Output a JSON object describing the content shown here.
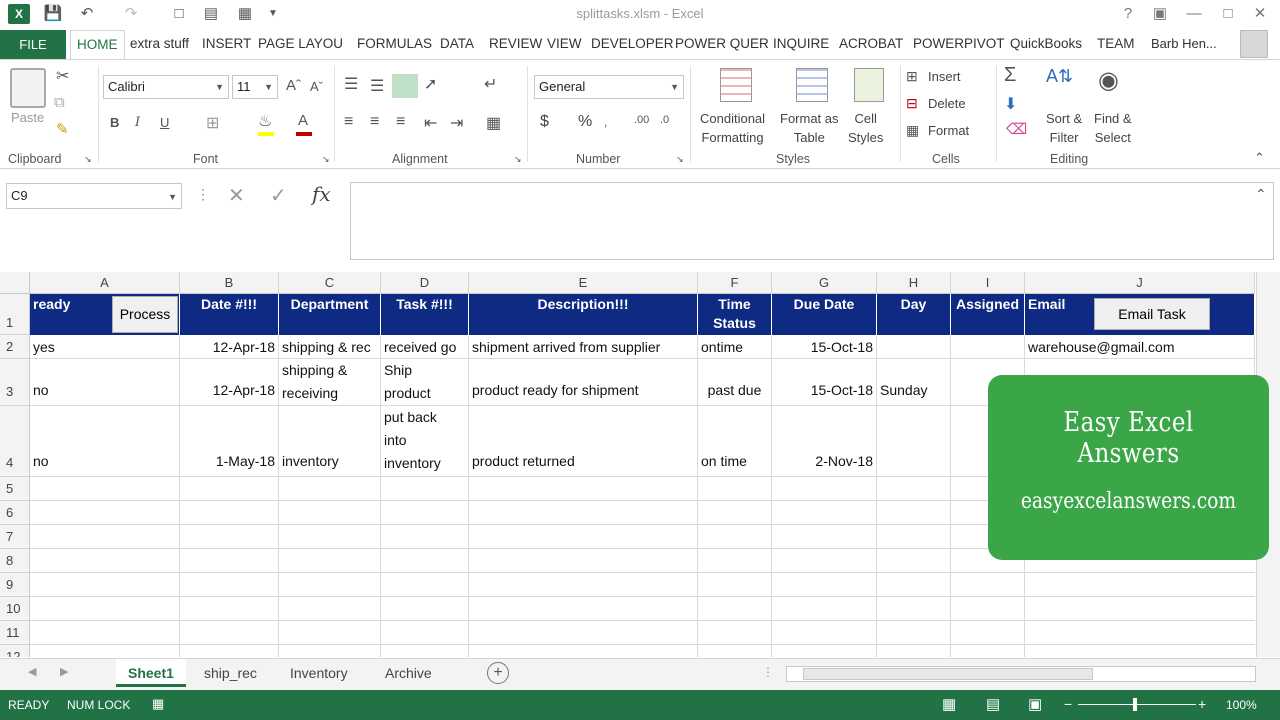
{
  "window": {
    "title": "splittasks.xlsm - Excel",
    "user": "Barb Hen..."
  },
  "tabs": [
    "FILE",
    "HOME",
    "extra stuff",
    "INSERT",
    "PAGE LAYOU",
    "FORMULAS",
    "DATA",
    "REVIEW",
    "VIEW",
    "DEVELOPER",
    "POWER QUER",
    "INQUIRE",
    "ACROBAT",
    "POWERPIVOT",
    "QuickBooks",
    "TEAM"
  ],
  "ribbon": {
    "clipboard": {
      "label": "Clipboard",
      "paste": "Paste"
    },
    "font": {
      "label": "Font",
      "name": "Calibri",
      "size": "11"
    },
    "alignment": {
      "label": "Alignment"
    },
    "number": {
      "label": "Number",
      "format": "General",
      "currency": "$",
      "percent": "%"
    },
    "styles": {
      "label": "Styles",
      "conditional1": "Conditional",
      "conditional2": "Formatting",
      "format_as1": "Format as",
      "format_as2": "Table",
      "cell1": "Cell",
      "cell2": "Styles"
    },
    "cells": {
      "label": "Cells",
      "insert": "Insert",
      "delete": "Delete",
      "format": "Format"
    },
    "editing": {
      "label": "Editing",
      "sort1": "Sort &",
      "sort2": "Filter",
      "find1": "Find &",
      "find2": "Select"
    }
  },
  "formula_bar": {
    "name_box": "C9",
    "formula": ""
  },
  "columns": [
    "A",
    "B",
    "C",
    "D",
    "E",
    "F",
    "G",
    "H",
    "I",
    "J"
  ],
  "rows": [
    "1",
    "2",
    "3",
    "4",
    "5",
    "6",
    "7",
    "8",
    "9",
    "10",
    "11",
    "12"
  ],
  "header_row": {
    "a": "ready",
    "process_button": "Process",
    "b": "Date #!!!",
    "c": "Department",
    "d": "Task #!!!",
    "e": "Description!!!",
    "f": "Time Status",
    "g": "Due Date",
    "h": "Day",
    "i": "Assigned",
    "j": "Email",
    "email_button": "Email Task"
  },
  "data_rows": [
    {
      "a": "yes",
      "b": "12-Apr-18",
      "c": "shipping & rec",
      "d": "received go",
      "e": "shipment arrived from supplier",
      "f": "ontime",
      "g": "15-Oct-18",
      "h": "",
      "i": "",
      "j": "warehouse@gmail.com"
    },
    {
      "a": "no",
      "b": "12-Apr-18",
      "c1": "shipping &",
      "c2": "receiving",
      "d1": "Ship",
      "d2": "product",
      "e": "product ready for shipment",
      "f": "past due",
      "g": "15-Oct-18",
      "h": "Sunday"
    },
    {
      "a": "no",
      "b": "1-May-18",
      "c": "inventory",
      "d1": "put back",
      "d2": "into",
      "d3": "inventory",
      "e": "product returned",
      "f": "on time",
      "g": "2-Nov-18"
    }
  ],
  "overlay": {
    "title": "Easy Excel Answers",
    "url": "easyexcelanswers.com"
  },
  "sheets": [
    "Sheet1",
    "ship_rec",
    "Inventory",
    "Archive"
  ],
  "status": {
    "ready": "READY",
    "numlock": "NUM LOCK",
    "zoom": "100%"
  }
}
